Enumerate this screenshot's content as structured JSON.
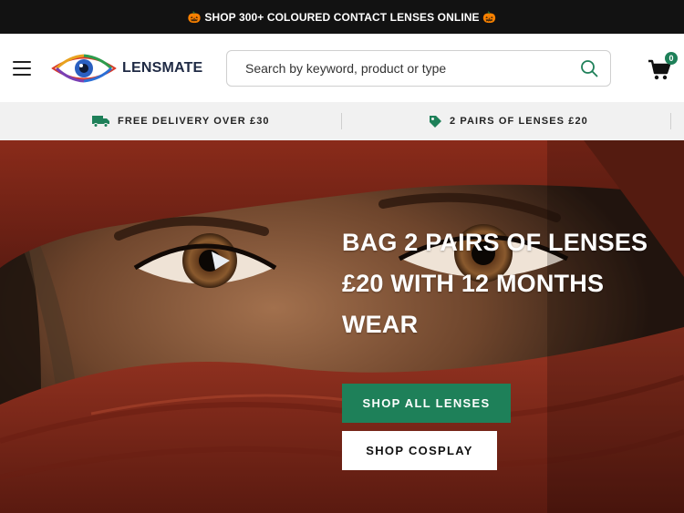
{
  "announcement": {
    "text": "🎃 SHOP 300+ COLOURED CONTACT LENSES ONLINE 🎃"
  },
  "header": {
    "menu_icon": "hamburger-icon",
    "logo_text": "LENSMATE",
    "search": {
      "placeholder": "Search by keyword, product or type",
      "value": "",
      "icon": "search-icon"
    },
    "cart": {
      "icon": "cart-icon",
      "count": "0"
    }
  },
  "usp": {
    "items": [
      {
        "icon": "delivery-truck-icon",
        "label": "FREE DELIVERY OVER £30"
      },
      {
        "icon": "price-tag-icon",
        "label": "2 PAIRS OF LENSES £20"
      }
    ]
  },
  "hero": {
    "heading": "BAG 2 PAIRS OF LENSES £20 WITH 12 MONTHS WEAR",
    "primary_button": "SHOP ALL LENSES",
    "secondary_button": "SHOP COSPLAY"
  },
  "colors": {
    "brand_green": "#1e8059",
    "announcement_bg": "#121212",
    "usp_bg": "#f1f1f1",
    "logo_text": "#1f2a44"
  }
}
